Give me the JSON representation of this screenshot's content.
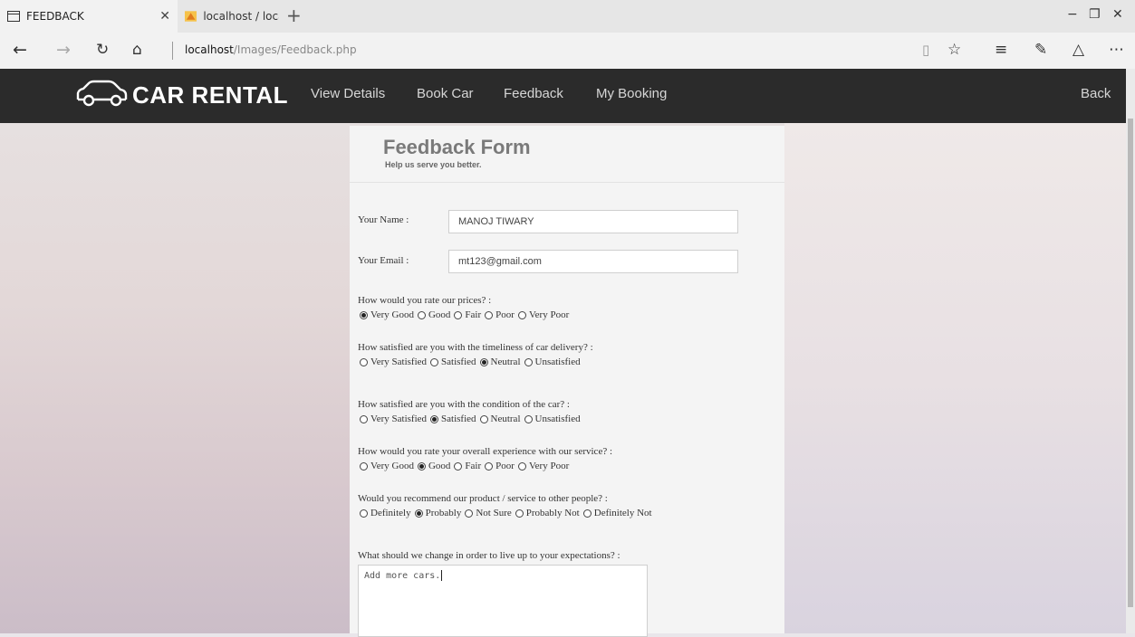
{
  "browser": {
    "tabs": [
      {
        "title": "FEEDBACK",
        "active": true,
        "icon": "page-icon"
      },
      {
        "title": "localhost / localhost / car_re",
        "active": false,
        "icon": "phpmyadmin-icon"
      }
    ],
    "url_host": "localhost",
    "url_path": "/Images/Feedback.php"
  },
  "site": {
    "logo_text": "CAR RENTAL",
    "nav": [
      "View Details",
      "Book Car",
      "Feedback",
      "My Booking"
    ],
    "back": "Back"
  },
  "form": {
    "title": "Feedback Form",
    "subtitle": "Help us serve you better.",
    "name_label": "Your Name :",
    "name_value": "MANOJ TIWARY",
    "email_label": "Your Email :",
    "email_value": "mt123@gmail.com",
    "questions": [
      {
        "text": "How would you rate our prices? :",
        "options": [
          "Very Good",
          "Good",
          "Fair",
          "Poor",
          "Very Poor"
        ],
        "selected": 0
      },
      {
        "text": "How satisfied are you with the timeliness of car delivery? :",
        "options": [
          "Very Satisfied",
          "Satisfied",
          "Neutral",
          "Unsatisfied"
        ],
        "selected": 2
      },
      {
        "text": "How satisfied are you with the condition of the car? :",
        "options": [
          "Very Satisfied",
          "Satisfied",
          "Neutral",
          "Unsatisfied"
        ],
        "selected": 1
      },
      {
        "text": "How would you rate your overall experience with our service? :",
        "options": [
          "Very Good",
          "Good",
          "Fair",
          "Poor",
          "Very Poor"
        ],
        "selected": 1
      },
      {
        "text": "Would you recommend our product / service to other people? :",
        "options": [
          "Definitely",
          "Probably",
          "Not Sure",
          "Probably Not",
          "Definitely Not"
        ],
        "selected": 1
      }
    ],
    "change_question": "What should we change in order to live up to your expectations? :",
    "change_value": "Add more cars."
  }
}
